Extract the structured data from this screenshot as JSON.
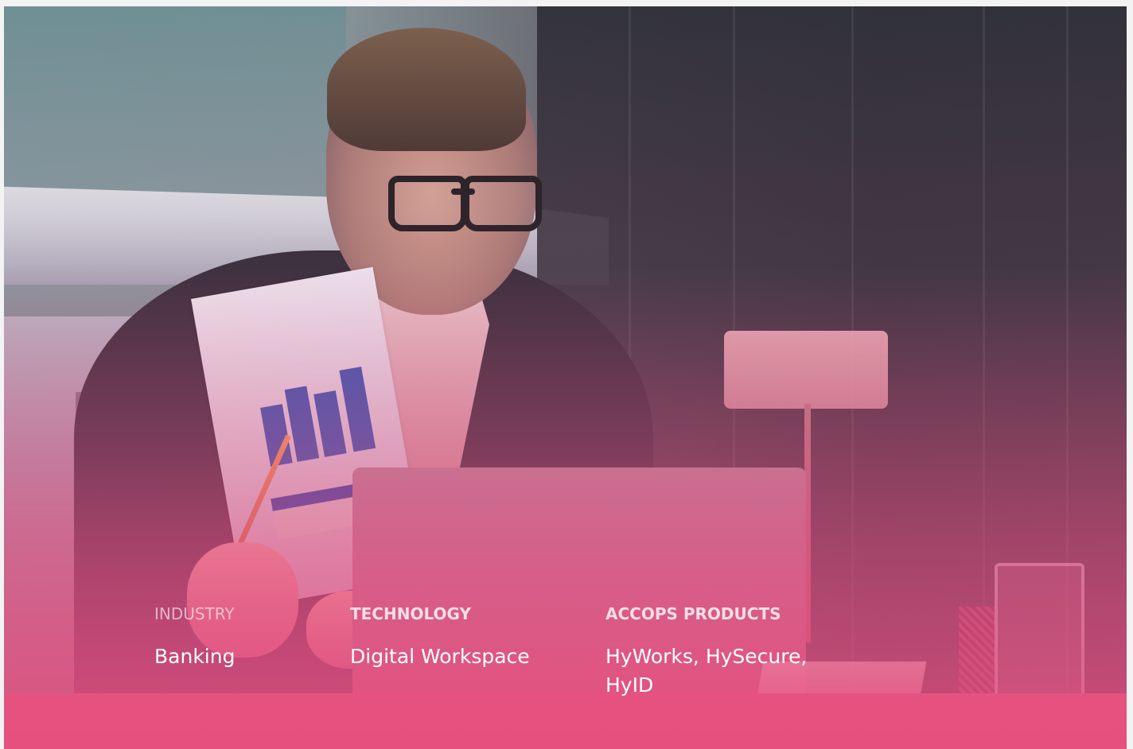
{
  "page": {
    "industry": {
      "label": "INDUSTRY",
      "value": "Banking"
    },
    "technology": {
      "label": "TECHNOLOGY",
      "value": "Digital Workspace"
    },
    "products": {
      "label": "ACCOPS PRODUCTS",
      "value": "HyWorks, HySecure,\nHyID"
    }
  },
  "image": {
    "subject": "businessman-with-report-and-laptop"
  },
  "colors": {
    "overlay_pink": "#E6507F",
    "text_white": "#FFFFFF"
  }
}
